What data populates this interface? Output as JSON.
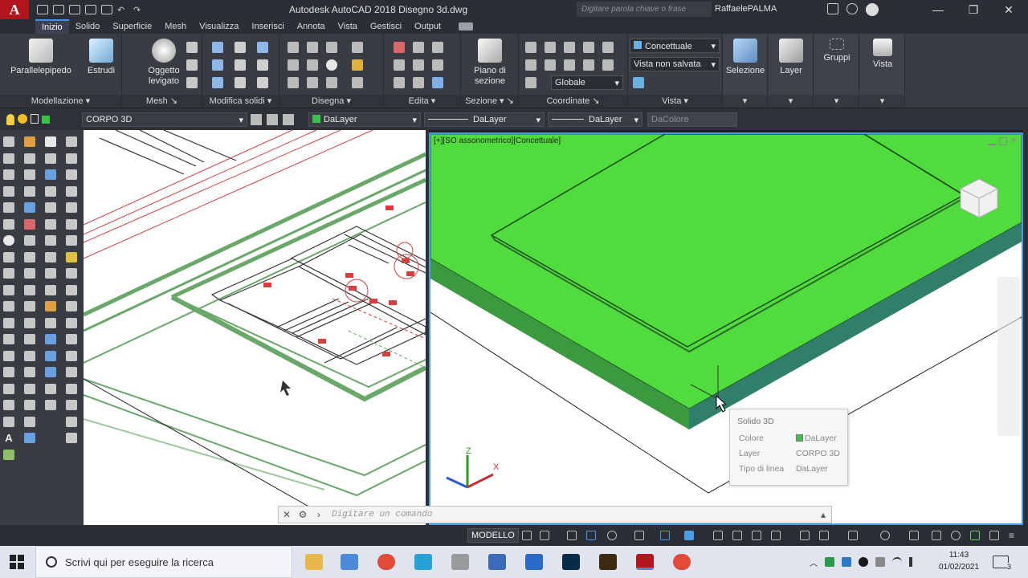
{
  "titlebar": {
    "app_letter": "A",
    "title": "Autodesk AutoCAD 2018   Disegno 3d.dwg",
    "search_placeholder": "Digitare parola chiave o frase",
    "user": "RaffaelePALMA",
    "minimize": "—",
    "restore": "❐",
    "close": "✕"
  },
  "tabs": [
    "Inizio",
    "Solido",
    "Superficie",
    "Mesh",
    "Visualizza",
    "Inserisci",
    "Annota",
    "Vista",
    "Gestisci",
    "Output"
  ],
  "ribbon": {
    "panels": {
      "modellazione": "Modellazione",
      "mesh": "Mesh",
      "modifica_solidi": "Modifica solidi",
      "disegna": "Disegna",
      "edita": "Edita",
      "sezione": "Sezione",
      "coordinate": "Coordinate",
      "vista": "Vista"
    },
    "buttons": {
      "parallelepipedo": "Parallelepipedo",
      "estrudi": "Estrudi",
      "oggetto_levigato_1": "Oggetto",
      "oggetto_levigato_2": "levigato",
      "piano_sezione_1": "Piano di",
      "piano_sezione_2": "sezione",
      "selezione": "Selezione",
      "layer": "Layer",
      "gruppi": "Gruppi",
      "vista": "Vista"
    },
    "visual_style": "Concettuale",
    "named_view": "Vista non salvata",
    "ucs": "Globale"
  },
  "props": {
    "layer": "CORPO 3D",
    "color": "DaLayer",
    "linetype": "DaLayer",
    "lineweight": "DaLayer",
    "plotstyle": "DaColore"
  },
  "viewport_right": {
    "label": "[+][SO assonometrico][Concettuale]"
  },
  "tooltip": {
    "title": "Solido 3D",
    "rows": [
      {
        "key": "Colore",
        "value": "DaLayer"
      },
      {
        "key": "Layer",
        "value": "CORPO 3D"
      },
      {
        "key": "Tipo di linea",
        "value": "DaLayer"
      }
    ]
  },
  "command": {
    "placeholder": "Digitare un comando"
  },
  "statusbar": {
    "model": "MODELLO"
  },
  "taskbar": {
    "search": "Scrivi qui per eseguire la ricerca",
    "time": "11:43",
    "date": "01/02/2021",
    "notifications": "3"
  },
  "colors": {
    "accent": "#4a9ae8",
    "solid_top": "#4fdc3c",
    "solid_side": "#2f7f6a",
    "layer_green": "#3cc24a",
    "autocad_red": "#b2151b"
  }
}
